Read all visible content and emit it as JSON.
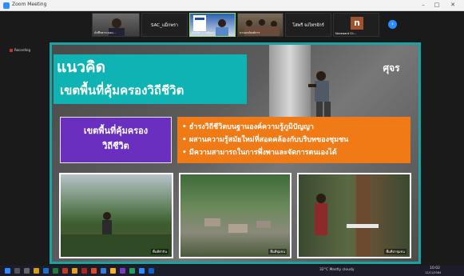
{
  "window": {
    "title": "Zoom Meeting",
    "minimize": "–",
    "maximize": "□",
    "close": "✕"
  },
  "sidebar": {
    "pinned_label": "Recording"
  },
  "participants": [
    {
      "name": "นักศึกษาระบอบ...",
      "type": "video"
    },
    {
      "name": "SAC_แม็กพรา",
      "type": "name"
    },
    {
      "name": "ปัณภัทร การพัฒนา",
      "type": "video",
      "active": true
    },
    {
      "name": "นามนรภัณฑ์การ",
      "type": "video"
    },
    {
      "name": "โสพรี จงไทรจักร์",
      "type": "name"
    },
    {
      "name": "Naraward Ch...",
      "type": "avatar",
      "initial": "n"
    }
  ],
  "slide": {
    "title_line1": "แนวคิด",
    "title_line2": "เขตพื้นที่คุ้มครองวิถีชีวิต",
    "logo": "ศุจร",
    "purple_line1": "เขตพื้นที่คุ้มครอง",
    "purple_line2": "วิถีชีวิต",
    "bullets": [
      "ธำรงวิถีชีวิตบนฐานองค์ความรู้ภูมิปัญญา",
      "ผสานความรู้สมัยใหม่ที่สอดคล้องกับบริบทของชุมชน",
      "มีความสามารถในการพึ่งพาและจัดการตนเองได้"
    ],
    "photos": [
      {
        "caption": "พื้นที่ทำกิน"
      },
      {
        "caption": "พื้นที่ชุมชน"
      },
      {
        "caption": "พื้นที่ป่าชุมชน"
      }
    ]
  },
  "taskbar": {
    "weather": "32°C Mostly cloudy",
    "time": "10:02",
    "date": "12/11/2564"
  },
  "colors": {
    "teal": "#10b3b3",
    "purple": "#6b2fbf",
    "orange": "#ef7a16",
    "zoom_blue": "#2d8cff"
  }
}
